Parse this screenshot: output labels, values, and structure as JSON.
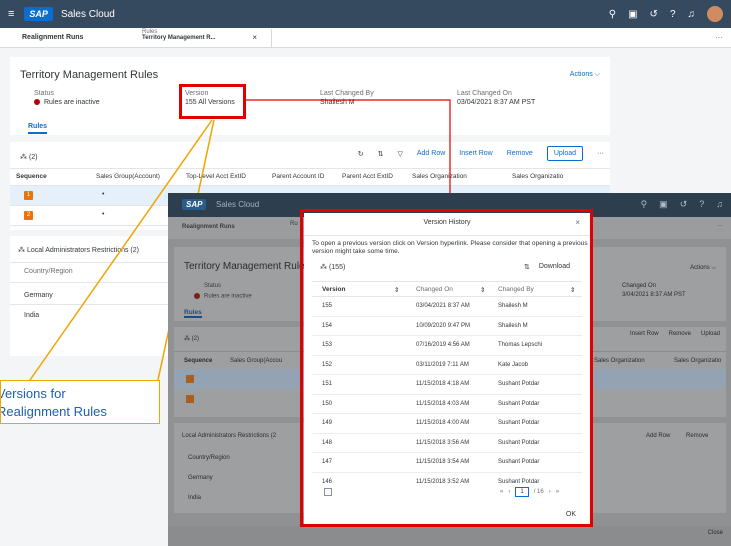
{
  "shell": {
    "menu_icon": "≡",
    "logo": "SAP",
    "title": "Sales Cloud",
    "icons": [
      "search-icon",
      "chat-icon",
      "history-icon",
      "help-icon",
      "bell-icon"
    ]
  },
  "tabs": {
    "tab1": "Realignment Runs",
    "tab2_sub": "Rules",
    "tab2_label": "Territory Management R...",
    "close": "×",
    "more": "···"
  },
  "header": {
    "title": "Territory Management Rules",
    "actions": "Actions ⌵",
    "status_label": "Status",
    "status_value": "Rules are inactive",
    "version_label": "Version",
    "version_value": "155  All Versions",
    "changed_by_label": "Last Changed By",
    "changed_by_value": "Shailesh M",
    "changed_on_label": "Last Changed On",
    "changed_on_value": "03/04/2021 8:37 AM PST",
    "rules_tab": "Rules"
  },
  "table": {
    "count": "(2)",
    "toolbar": {
      "add_row": "Add Row",
      "insert_row": "Insert Row",
      "remove": "Remove",
      "upload": "Upload",
      "more": "···"
    },
    "columns": [
      "Sequence",
      "Sales Group(Account)",
      "Top-Level Acct ExtID",
      "Parent Account ID",
      "Parent Acct ExtID",
      "Sales Organization",
      "Sales Organizatio"
    ],
    "rows": [
      {
        "seq": "1",
        "group": "•"
      },
      {
        "seq": "2",
        "group": "•"
      }
    ]
  },
  "admin": {
    "title": "Local Administrators Restrictions  (2)",
    "column": "Country/Region",
    "rows": [
      "Germany",
      "India"
    ]
  },
  "callout": {
    "line1": "Versions for",
    "line2": "Realignment Rules"
  },
  "win2": {
    "title": "Sales Cloud",
    "tab1": "Realignment Runs",
    "tab2": "Ru",
    "header_title": "Territory Management Rules",
    "status": "Status",
    "status_value": "Rules are inactive",
    "actions": "Actions ⌵",
    "changed_on_label": "Changed On",
    "changed_on_value": "3/04/2021 8:37 AM PST",
    "rules_tab": "Rules",
    "table_count": "(2)",
    "seq_col": "Sequence",
    "group_col": "Sales Group(Accou",
    "insert_row": "Insert Row",
    "remove": "Remove",
    "upload": "Upload",
    "sales_org": "Sales Organization",
    "sales_org2": "Sales Organizatio",
    "admin_title": "Local Administrators Restrictions (2",
    "country": "Country/Region",
    "germany": "Germany",
    "india": "India",
    "add_row": "Add Row",
    "remove2": "Remove",
    "close": "Close"
  },
  "dialog": {
    "title": "Version History",
    "message": "To open a previous version click on Version hyperlink. Please consider that opening a previous version might take some time.",
    "count": "(155)",
    "download": "Download",
    "columns": [
      "Version",
      "Changed On",
      "Changed By"
    ],
    "rows": [
      {
        "version": "155",
        "changed_on": "03/04/2021 8:37 AM",
        "changed_by": "Shailesh M"
      },
      {
        "version": "154",
        "changed_on": "10/09/2020 9:47 PM",
        "changed_by": "Shailesh M"
      },
      {
        "version": "153",
        "changed_on": "07/16/2019 4:56 AM",
        "changed_by": "Thomas Lepschi"
      },
      {
        "version": "152",
        "changed_on": "03/11/2019 7:11 AM",
        "changed_by": "Kate Jacob"
      },
      {
        "version": "151",
        "changed_on": "11/15/2018 4:18 AM",
        "changed_by": "Sushant Potdar"
      },
      {
        "version": "150",
        "changed_on": "11/15/2018 4:03 AM",
        "changed_by": "Sushant Potdar"
      },
      {
        "version": "149",
        "changed_on": "11/15/2018 4:00 AM",
        "changed_by": "Sushant Potdar"
      },
      {
        "version": "148",
        "changed_on": "11/15/2018 3:56 AM",
        "changed_by": "Sushant Potdar"
      },
      {
        "version": "147",
        "changed_on": "11/15/2018 3:54 AM",
        "changed_by": "Sushant Potdar"
      },
      {
        "version": "146",
        "changed_on": "11/15/2018 3:52 AM",
        "changed_by": "Sushant Potdar"
      }
    ],
    "pager_page": "1",
    "pager_total": "/ 16",
    "ok": "OK"
  },
  "colors": {
    "shell": "#354a5f",
    "accent": "#0a6ed1",
    "highlight_box": "#e00000",
    "callout_border": "#f0a500",
    "callout_text": "#1d5fb0",
    "inactive_dot": "#bb0000",
    "sequence_badge": "#e9730c"
  }
}
